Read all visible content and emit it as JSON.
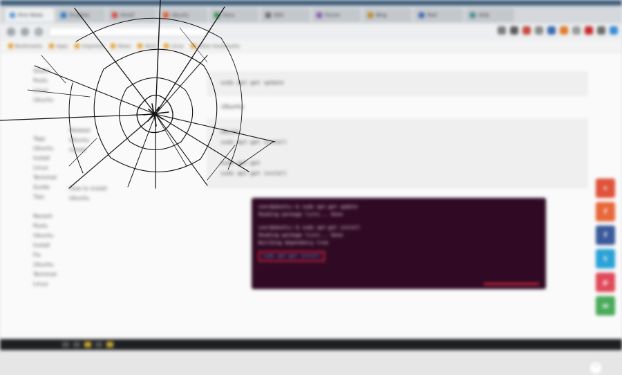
{
  "browser": {
    "tabs": [
      {
        "label": "Rivo News",
        "color": "#5c9ad6"
      },
      {
        "label": "Dropbox",
        "color": "#2c78c8"
      },
      {
        "label": "Gmail",
        "color": "#d44a3a"
      },
      {
        "label": "Ubuntu",
        "color": "#e05a2a"
      },
      {
        "label": "Docs",
        "color": "#3a8a4a"
      },
      {
        "label": "Wiki",
        "color": "#6a6a6a"
      },
      {
        "label": "Forum",
        "color": "#8a5ab0"
      },
      {
        "label": "Blog",
        "color": "#c08a2a"
      },
      {
        "label": "Mail",
        "color": "#3a6ab0"
      },
      {
        "label": "Help",
        "color": "#4a8a8a"
      }
    ],
    "url": "",
    "bookmarks": [
      "Bookmarks",
      "Apps",
      "Imported",
      "News",
      "Work",
      "Linux",
      "Other bookmarks"
    ],
    "extension_colors": [
      "#7a7a7a",
      "#5a5a5a",
      "#c44a3a",
      "#8a8a8a",
      "#3a6ab0",
      "#e07a2a",
      "#9a9a9a",
      "#c82a2a",
      "#6a6a6a",
      "#3a8ad6"
    ]
  },
  "sidebar_lines": [
    "Share",
    "Posts",
    "Linux",
    "Ubuntu",
    "",
    "",
    "",
    "Tags",
    "Ubuntu",
    "Install",
    "Linux",
    "Terminal",
    "Guide",
    "Tips",
    "",
    "Recent",
    "Posts",
    "Ubuntu",
    "Install",
    "Fix",
    "Ubuntu",
    "Terminal",
    "Linux"
  ],
  "col2_lines": [
    "Related",
    "Ubuntu",
    "install",
    "",
    "",
    "",
    "How to install",
    "Ubuntu"
  ],
  "content": {
    "code1": "sudo apt-get update",
    "heading": "Ubuntu",
    "code2_lines": [
      "Ubuntu",
      "sudo apt-get install",
      "",
      "sudo apt-get",
      "sudo apt-get install"
    ]
  },
  "terminal": {
    "lines": [
      "user@ubuntu:~$ sudo apt-get update",
      "Reading package lists... Done",
      "",
      "user@ubuntu:~$ sudo apt-get install",
      "Reading package lists... Done",
      "Building dependency tree"
    ],
    "highlight": "sudo apt-get install"
  },
  "share_buttons": [
    {
      "name": "share-button-1",
      "color": "#e0523a",
      "glyph": "+"
    },
    {
      "name": "share-button-2",
      "color": "#e8673a",
      "glyph": "f"
    },
    {
      "name": "share-button-3",
      "color": "#3a5a9a",
      "glyph": "f"
    },
    {
      "name": "share-button-4",
      "color": "#2aa2d6",
      "glyph": "t"
    },
    {
      "name": "share-button-5",
      "color": "#e04a5a",
      "glyph": "p"
    },
    {
      "name": "share-button-6",
      "color": "#4aaa5a",
      "glyph": "w"
    }
  ],
  "colors": {
    "terminal_bg": "#300a24",
    "highlight_border": "#d6243c"
  }
}
